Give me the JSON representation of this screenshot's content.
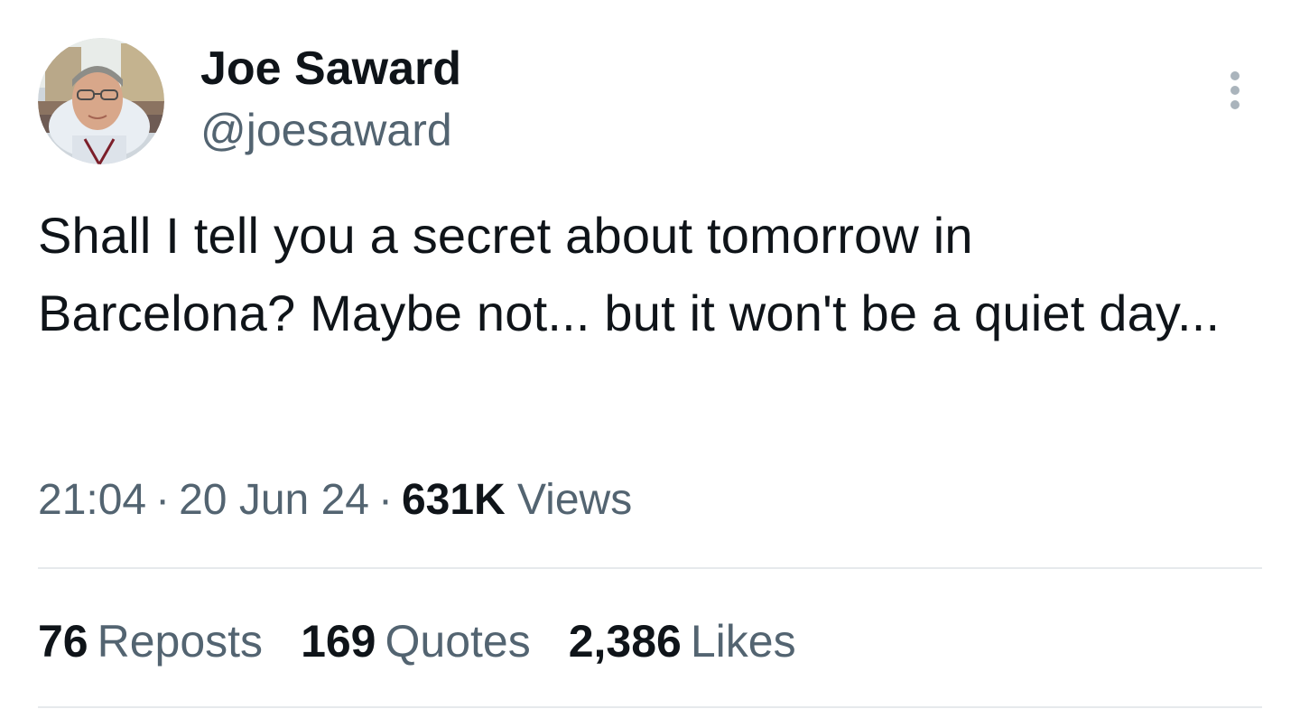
{
  "author": {
    "display_name": "Joe Saward",
    "handle": "@joesaward",
    "avatar_icon": "profile-photo"
  },
  "more_icon": "more-vertical-icon",
  "tweet": {
    "text": "Shall I tell you a secret about tomorrow in Barcelona? Maybe not... but it won't be a quiet day..."
  },
  "meta": {
    "time": "21:04",
    "separator": "·",
    "date": "20 Jun 24",
    "views_count": "631K",
    "views_label": "Views"
  },
  "stats": {
    "reposts_count": "76",
    "reposts_label": "Reposts",
    "quotes_count": "169",
    "quotes_label": "Quotes",
    "likes_count": "2,386",
    "likes_label": "Likes"
  },
  "colors": {
    "primary_text": "#0f1419",
    "secondary_text": "#536471",
    "divider": "#e6e9ec",
    "background": "#ffffff"
  }
}
